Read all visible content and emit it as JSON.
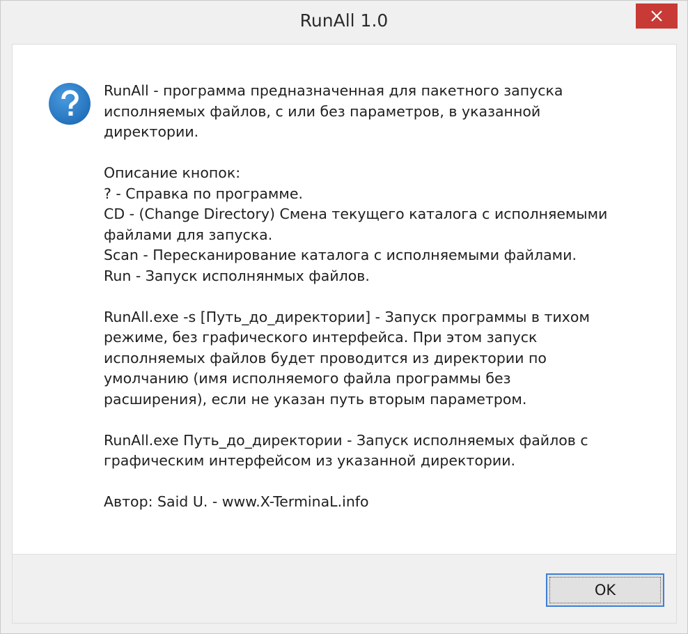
{
  "window": {
    "title": "RunAll 1.0",
    "close_icon": "close-icon",
    "close_color": "#c73a35"
  },
  "dialog": {
    "icon": "question-icon",
    "icon_color": "#2a7ec8",
    "paragraphs": [
      [
        "RunAll - программа предназначенная для пакетного запуска",
        "исполняемых файлов, с или без параметров, в указанной",
        "директории."
      ],
      [
        "Описание кнопок:",
        "? - Справка по программе.",
        "CD - (Change Directory) Смена текущего каталога с исполняемыми",
        "файлами для запуска.",
        "Scan - Пересканирование каталога с исполняемыми файлами.",
        "Run - Запуск исполнянмых файлов."
      ],
      [
        "RunAll.exe -s [Путь_до_директории] - Запуск программы в тихом",
        "режиме, без графического интерфейса. При этом запуск",
        "исполняемых файлов будет проводится из директории по",
        "умолчанию (имя исполняемого файла программы без",
        "расширения), если не указан путь вторым параметром."
      ],
      [
        "RunAll.exe Путь_до_директории - Запуск исполняемых файлов с",
        "графическим интерфейсом из указанной директории."
      ],
      [
        "Автор: Said U. - www.X-TerminaL.info"
      ]
    ]
  },
  "footer": {
    "ok_label": "OK",
    "ok_border_color": "#3c7fd6"
  }
}
